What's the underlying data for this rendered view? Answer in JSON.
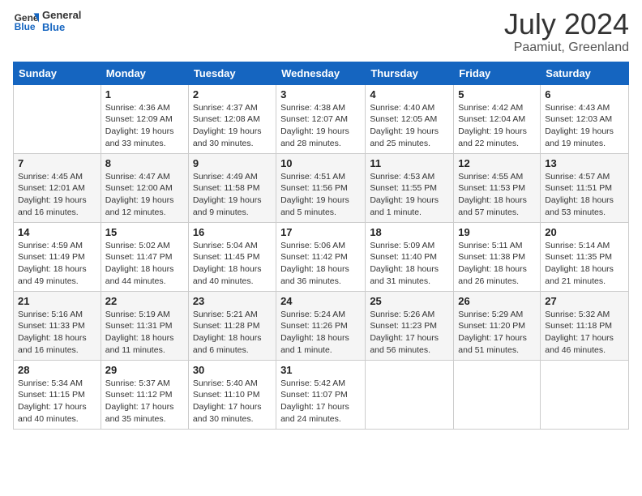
{
  "header": {
    "logo_general": "General",
    "logo_blue": "Blue",
    "month": "July 2024",
    "location": "Paamiut, Greenland"
  },
  "days_of_week": [
    "Sunday",
    "Monday",
    "Tuesday",
    "Wednesday",
    "Thursday",
    "Friday",
    "Saturday"
  ],
  "weeks": [
    [
      {
        "day": "",
        "info": ""
      },
      {
        "day": "1",
        "info": "Sunrise: 4:36 AM\nSunset: 12:09 AM\nDaylight: 19 hours\nand 33 minutes."
      },
      {
        "day": "2",
        "info": "Sunrise: 4:37 AM\nSunset: 12:08 AM\nDaylight: 19 hours\nand 30 minutes."
      },
      {
        "day": "3",
        "info": "Sunrise: 4:38 AM\nSunset: 12:07 AM\nDaylight: 19 hours\nand 28 minutes."
      },
      {
        "day": "4",
        "info": "Sunrise: 4:40 AM\nSunset: 12:05 AM\nDaylight: 19 hours\nand 25 minutes."
      },
      {
        "day": "5",
        "info": "Sunrise: 4:42 AM\nSunset: 12:04 AM\nDaylight: 19 hours\nand 22 minutes."
      },
      {
        "day": "6",
        "info": "Sunrise: 4:43 AM\nSunset: 12:03 AM\nDaylight: 19 hours\nand 19 minutes."
      }
    ],
    [
      {
        "day": "7",
        "info": "Sunrise: 4:45 AM\nSunset: 12:01 AM\nDaylight: 19 hours\nand 16 minutes."
      },
      {
        "day": "8",
        "info": "Sunrise: 4:47 AM\nSunset: 12:00 AM\nDaylight: 19 hours\nand 12 minutes."
      },
      {
        "day": "9",
        "info": "Sunrise: 4:49 AM\nSunset: 11:58 PM\nDaylight: 19 hours\nand 9 minutes."
      },
      {
        "day": "10",
        "info": "Sunrise: 4:51 AM\nSunset: 11:56 PM\nDaylight: 19 hours\nand 5 minutes."
      },
      {
        "day": "11",
        "info": "Sunrise: 4:53 AM\nSunset: 11:55 PM\nDaylight: 19 hours\nand 1 minute."
      },
      {
        "day": "12",
        "info": "Sunrise: 4:55 AM\nSunset: 11:53 PM\nDaylight: 18 hours\nand 57 minutes."
      },
      {
        "day": "13",
        "info": "Sunrise: 4:57 AM\nSunset: 11:51 PM\nDaylight: 18 hours\nand 53 minutes."
      }
    ],
    [
      {
        "day": "14",
        "info": "Sunrise: 4:59 AM\nSunset: 11:49 PM\nDaylight: 18 hours\nand 49 minutes."
      },
      {
        "day": "15",
        "info": "Sunrise: 5:02 AM\nSunset: 11:47 PM\nDaylight: 18 hours\nand 44 minutes."
      },
      {
        "day": "16",
        "info": "Sunrise: 5:04 AM\nSunset: 11:45 PM\nDaylight: 18 hours\nand 40 minutes."
      },
      {
        "day": "17",
        "info": "Sunrise: 5:06 AM\nSunset: 11:42 PM\nDaylight: 18 hours\nand 36 minutes."
      },
      {
        "day": "18",
        "info": "Sunrise: 5:09 AM\nSunset: 11:40 PM\nDaylight: 18 hours\nand 31 minutes."
      },
      {
        "day": "19",
        "info": "Sunrise: 5:11 AM\nSunset: 11:38 PM\nDaylight: 18 hours\nand 26 minutes."
      },
      {
        "day": "20",
        "info": "Sunrise: 5:14 AM\nSunset: 11:35 PM\nDaylight: 18 hours\nand 21 minutes."
      }
    ],
    [
      {
        "day": "21",
        "info": "Sunrise: 5:16 AM\nSunset: 11:33 PM\nDaylight: 18 hours\nand 16 minutes."
      },
      {
        "day": "22",
        "info": "Sunrise: 5:19 AM\nSunset: 11:31 PM\nDaylight: 18 hours\nand 11 minutes."
      },
      {
        "day": "23",
        "info": "Sunrise: 5:21 AM\nSunset: 11:28 PM\nDaylight: 18 hours\nand 6 minutes."
      },
      {
        "day": "24",
        "info": "Sunrise: 5:24 AM\nSunset: 11:26 PM\nDaylight: 18 hours\nand 1 minute."
      },
      {
        "day": "25",
        "info": "Sunrise: 5:26 AM\nSunset: 11:23 PM\nDaylight: 17 hours\nand 56 minutes."
      },
      {
        "day": "26",
        "info": "Sunrise: 5:29 AM\nSunset: 11:20 PM\nDaylight: 17 hours\nand 51 minutes."
      },
      {
        "day": "27",
        "info": "Sunrise: 5:32 AM\nSunset: 11:18 PM\nDaylight: 17 hours\nand 46 minutes."
      }
    ],
    [
      {
        "day": "28",
        "info": "Sunrise: 5:34 AM\nSunset: 11:15 PM\nDaylight: 17 hours\nand 40 minutes."
      },
      {
        "day": "29",
        "info": "Sunrise: 5:37 AM\nSunset: 11:12 PM\nDaylight: 17 hours\nand 35 minutes."
      },
      {
        "day": "30",
        "info": "Sunrise: 5:40 AM\nSunset: 11:10 PM\nDaylight: 17 hours\nand 30 minutes."
      },
      {
        "day": "31",
        "info": "Sunrise: 5:42 AM\nSunset: 11:07 PM\nDaylight: 17 hours\nand 24 minutes."
      },
      {
        "day": "",
        "info": ""
      },
      {
        "day": "",
        "info": ""
      },
      {
        "day": "",
        "info": ""
      }
    ]
  ]
}
